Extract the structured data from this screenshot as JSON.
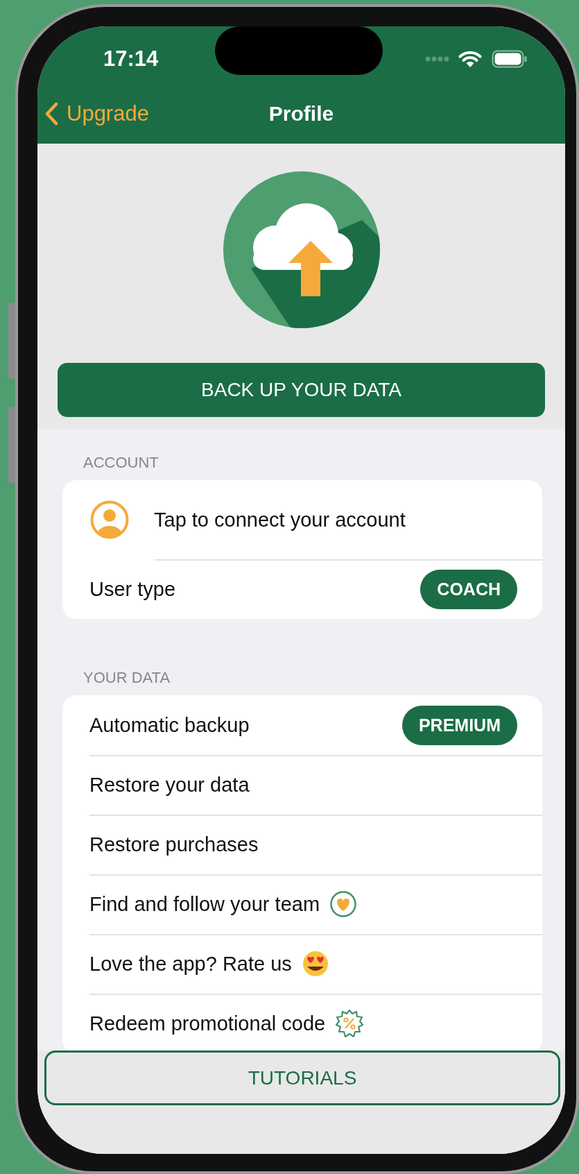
{
  "status_bar": {
    "time": "17:14"
  },
  "nav": {
    "back_label": "Upgrade",
    "title": "Profile"
  },
  "backup_button": {
    "label": "BACK UP YOUR DATA"
  },
  "sections": [
    {
      "header": "ACCOUNT",
      "rows": [
        {
          "kind": "account",
          "label": "Tap to connect your account"
        },
        {
          "kind": "badge",
          "label": "User type",
          "badge": "COACH"
        }
      ]
    },
    {
      "header": "YOUR DATA",
      "rows": [
        {
          "kind": "badge",
          "label": "Automatic backup",
          "badge": "PREMIUM"
        },
        {
          "kind": "plain",
          "label": "Restore your data"
        },
        {
          "kind": "plain",
          "label": "Restore purchases"
        },
        {
          "kind": "team",
          "label": "Find and follow your team"
        },
        {
          "kind": "rate",
          "label": "Love the app? Rate us"
        },
        {
          "kind": "promo",
          "label": "Redeem promotional code"
        }
      ]
    }
  ],
  "tutorials_button": {
    "label": "TUTORIALS"
  }
}
